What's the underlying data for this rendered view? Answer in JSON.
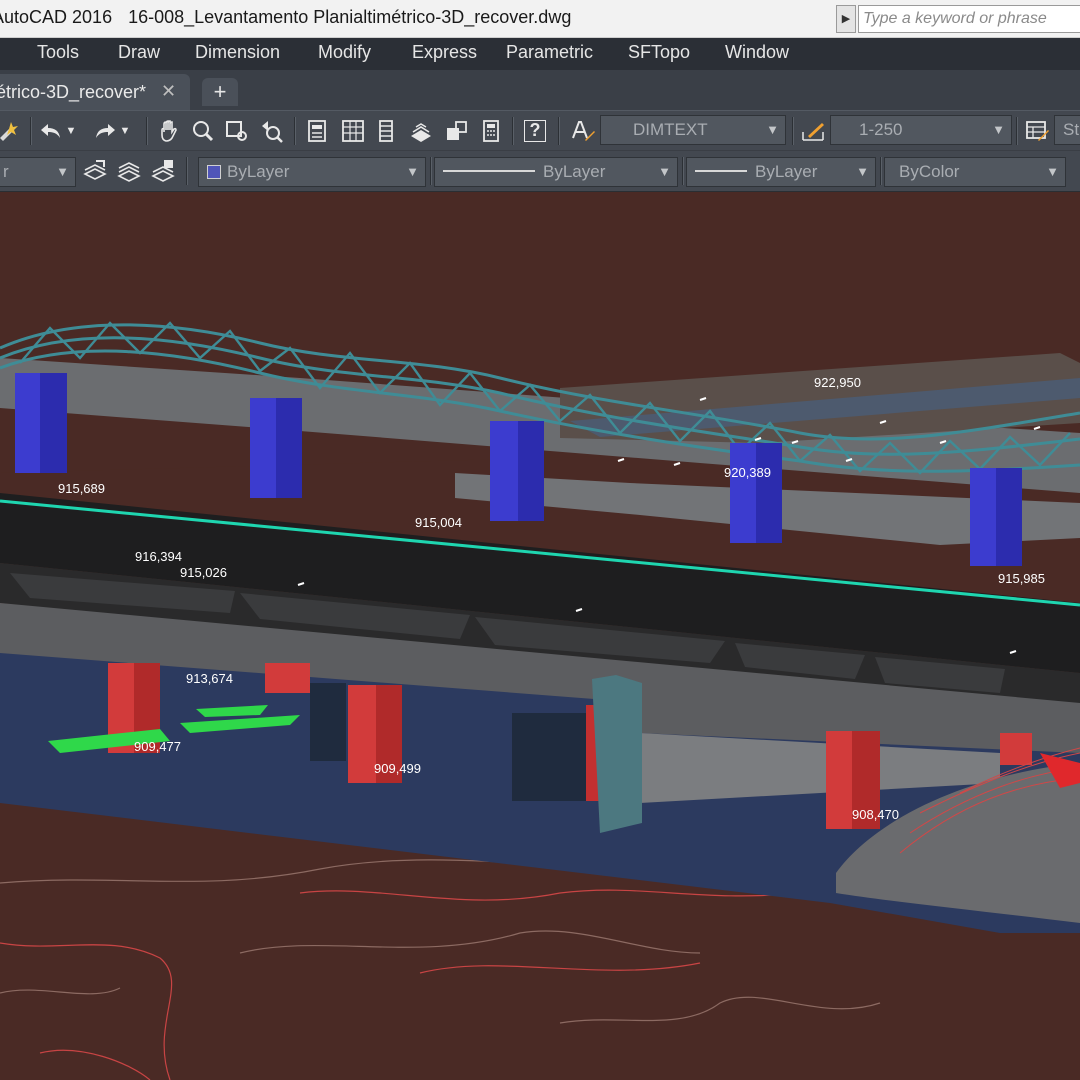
{
  "titlebar": {
    "app_name": "AutoCAD 2016",
    "file_name": "16-008_Levantamento Planialtimétrico-3D_recover.dwg",
    "search_placeholder": "Type a keyword or phrase"
  },
  "menu": {
    "items": [
      "Tools",
      "Draw",
      "Dimension",
      "Modify",
      "Express",
      "Parametric",
      "SFTopo",
      "Window"
    ]
  },
  "tabs": {
    "active_label": "étrico-3D_recover*",
    "close_glyph": "✕",
    "new_glyph": "+"
  },
  "toolbar": {
    "help_glyph": "?",
    "text_style": "DIMTEXT",
    "dim_scale": "1-250",
    "standard_partial": "St"
  },
  "properties": {
    "layer_partial": "r",
    "color": "ByLayer",
    "linetype": "ByLayer",
    "lineweight": "ByLayer",
    "plotstyle": "ByColor",
    "swatch_color": "#5055b8"
  },
  "viewport": {
    "elevation_labels": [
      "915,689",
      "915,004",
      "916,394",
      "915,026",
      "913,674",
      "909,477",
      "909,499",
      "908,470",
      "922,950",
      "920,389",
      "915,985"
    ],
    "colors": {
      "background": "#4a2a25",
      "ground": "#2c3a5f",
      "truss": "#3f8c96",
      "blue_pillar": "#3c3ccf",
      "red_pillar": "#d23b3b",
      "deck": "#1e1e1f",
      "edge_line": "#1fd6b0",
      "contours": "#d04848"
    }
  }
}
